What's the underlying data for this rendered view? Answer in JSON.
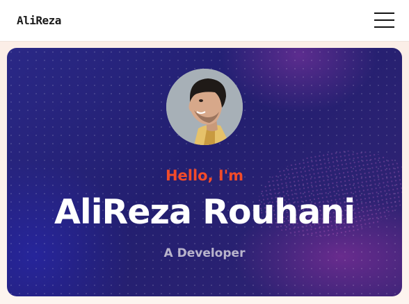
{
  "header": {
    "logo_text": "AliReza",
    "menu_icon": "hamburger-menu-icon"
  },
  "hero": {
    "avatar_alt": "profile photo",
    "greeting": "Hello, I'm",
    "name": "AliReza Rouhani",
    "role": "A Developer"
  },
  "colors": {
    "accent": "#f24b2a",
    "hero_bg": "#231f70",
    "name_text": "#ffffff",
    "role_text": "#b9b4cc"
  }
}
